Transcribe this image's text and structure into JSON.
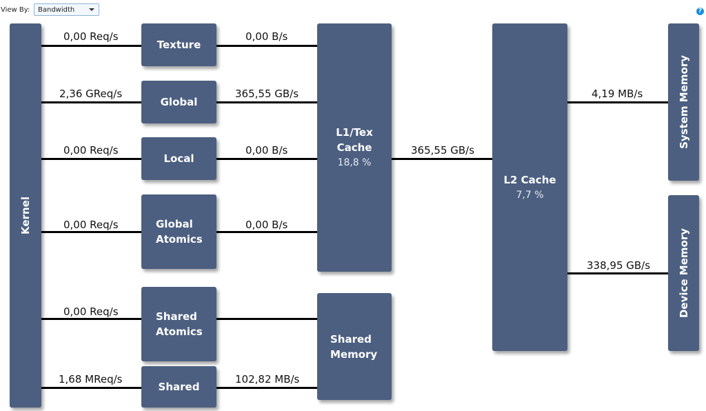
{
  "toolbar": {
    "view_by_label": "View By:",
    "view_by_value": "Bandwidth",
    "help_icon": "?"
  },
  "colors": {
    "box_fill": "#4c5f80",
    "help_icon": "#1a8fe3",
    "line": "#000000"
  },
  "nodes": {
    "kernel": "Kernel",
    "texture": "Texture",
    "global": "Global",
    "local": "Local",
    "global_atomics_1": "Global",
    "global_atomics_2": "Atomics",
    "shared_atomics_1": "Shared",
    "shared_atomics_2": "Atomics",
    "shared": "Shared",
    "l1_1": "L1/Tex",
    "l1_2": "Cache",
    "l1_pct": "18,8 %",
    "shared_memory_1": "Shared",
    "shared_memory_2": "Memory",
    "l2": "L2 Cache",
    "l2_pct": "7,7 %",
    "system_memory": "System Memory",
    "device_memory": "Device Memory"
  },
  "links": {
    "kernel_texture": "0,00 Req/s",
    "kernel_global": "2,36 GReq/s",
    "kernel_local": "0,00 Req/s",
    "kernel_global_atomics": "0,00 Req/s",
    "kernel_shared_atomics": "0,00 Req/s",
    "kernel_shared": "1,68 MReq/s",
    "texture_l1": "0,00 B/s",
    "global_l1": "365,55 GB/s",
    "local_l1": "0,00 B/s",
    "global_atomics_l1": "0,00 B/s",
    "shared_atomics_shmem": "",
    "shared_shmem": "102,82 MB/s",
    "l1_l2": "365,55 GB/s",
    "l2_system": "4,19 MB/s",
    "l2_device": "338,95 GB/s"
  }
}
